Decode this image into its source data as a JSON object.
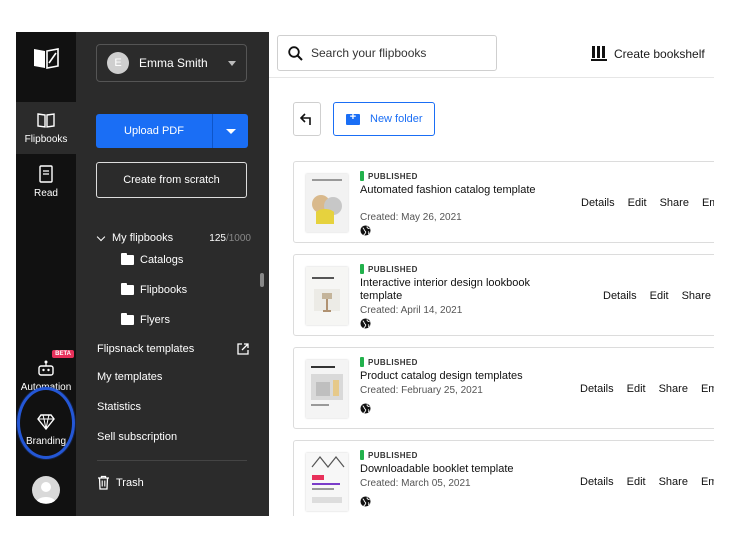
{
  "rail": {
    "items": [
      {
        "label": "Flipbooks",
        "icon": "flipbooks-icon"
      },
      {
        "label": "Read",
        "icon": "read-icon"
      },
      {
        "label": "Automation",
        "icon": "automation-icon",
        "badge": "BETA"
      },
      {
        "label": "Branding",
        "icon": "diamond-icon"
      }
    ]
  },
  "sidebar": {
    "user": {
      "initial": "E",
      "name": "Emma Smith"
    },
    "upload_label": "Upload PDF",
    "scratch_label": "Create from scratch",
    "my_flipbooks": {
      "label": "My flipbooks",
      "count": "125",
      "max": "/1000"
    },
    "folders": [
      "Catalogs",
      "Flipbooks",
      "Flyers"
    ],
    "links": [
      "Flipsnack templates",
      "My templates",
      "Statistics",
      "Sell subscription"
    ],
    "trash_label": "Trash"
  },
  "topbar": {
    "search_placeholder": "Search your flipbooks",
    "bookshelf_label": "Create bookshelf"
  },
  "toolbar": {
    "new_folder_label": "New folder"
  },
  "cards": [
    {
      "status": "PUBLISHED",
      "title": "Automated fashion catalog template",
      "date": "Created: May 26, 2021",
      "actions": [
        "Details",
        "Edit",
        "Share",
        "Emb"
      ]
    },
    {
      "status": "PUBLISHED",
      "title": "Interactive interior design lookbook template",
      "date": "Created: April 14, 2021",
      "actions": [
        "Details",
        "Edit",
        "Share"
      ]
    },
    {
      "status": "PUBLISHED",
      "title": "Product catalog design templates",
      "date": "Created: February 25, 2021",
      "actions": [
        "Details",
        "Edit",
        "Share",
        "Emb"
      ]
    },
    {
      "status": "PUBLISHED",
      "title": "Downloadable booklet template",
      "date": "Created: March 05, 2021",
      "actions": [
        "Details",
        "Edit",
        "Share",
        "Emb"
      ]
    }
  ],
  "colors": {
    "accent": "#1a6ef5",
    "published": "#22b14c",
    "beta": "#e8315b",
    "rail": "#111111",
    "sidebar": "#2b2b2b"
  }
}
